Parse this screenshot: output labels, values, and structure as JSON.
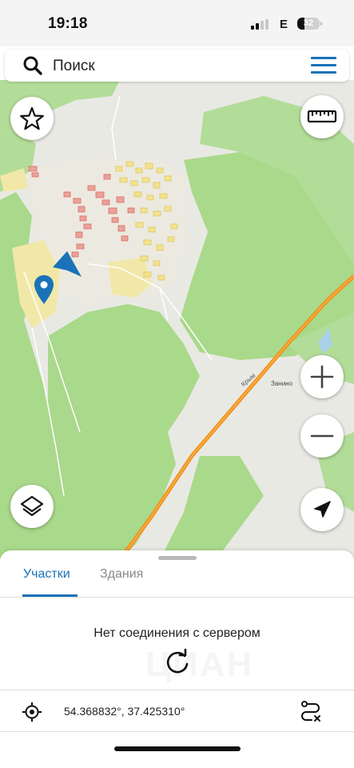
{
  "status_bar": {
    "time": "19:18",
    "network": "E",
    "battery": "32",
    "battery_level_percent": 32,
    "signal_bars_active": 2,
    "signal_bars_total": 4
  },
  "search": {
    "placeholder": "Поиск",
    "value": "",
    "icon": "search-icon"
  },
  "menu": {
    "icon": "hamburger-menu-icon",
    "color": "#1a73b8"
  },
  "map": {
    "place_label": "Занино",
    "road_label": "Крым",
    "buttons": {
      "favorites": "star-icon",
      "ruler": "ruler-icon",
      "zoom_in": "plus-icon",
      "zoom_out": "minus-icon",
      "layers": "layers-icon",
      "locate": "navigation-arrow-icon"
    },
    "colors": {
      "forest": "#a9d98a",
      "open_land": "#e9e9e4",
      "highway": "#f0921c",
      "marker": "#1a73b8",
      "parcels_red": "#e06b63",
      "parcels_yellow": "#f1e089"
    }
  },
  "panel": {
    "tabs": [
      {
        "label": "Участки",
        "active": true
      },
      {
        "label": "Здания",
        "active": false
      }
    ],
    "message": "Нет соединения с сервером",
    "watermark": "ЦИАН",
    "coordinates": "54.368832°, 37.425310°",
    "icons": {
      "refresh": "refresh-icon",
      "location": "crosshair-target-icon",
      "route": "route-icon"
    }
  }
}
